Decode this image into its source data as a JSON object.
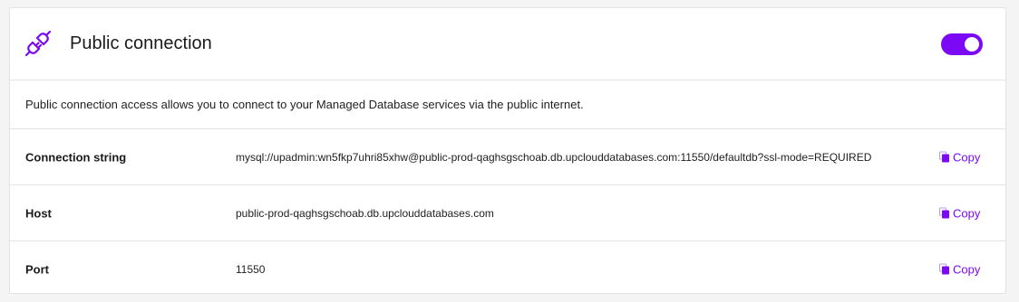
{
  "panel": {
    "title": "Public connection",
    "toggle_state": "on",
    "accent_color": "#7b09f6",
    "icon": "plug-icon",
    "description": "Public connection access allows you to connect to your Managed Database services via the public internet."
  },
  "rows": [
    {
      "label": "Connection string",
      "value": "mysql://upadmin:wn5fkp7uhri85xhw@public-prod-qaghsgschoab.db.upclouddatabases.com:11550/defaultdb?ssl-mode=REQUIRED",
      "copy_label": "Copy"
    },
    {
      "label": "Host",
      "value": "public-prod-qaghsgschoab.db.upclouddatabases.com",
      "copy_label": "Copy"
    },
    {
      "label": "Port",
      "value": "11550",
      "copy_label": "Copy"
    }
  ]
}
